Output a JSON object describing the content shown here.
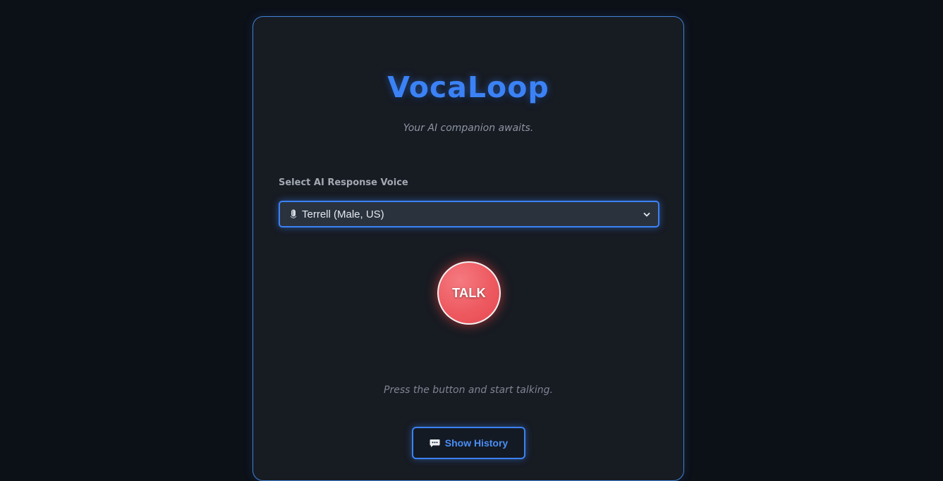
{
  "app": {
    "title": "VocaLoop",
    "subtitle": "Your AI companion awaits."
  },
  "voice": {
    "label": "Select AI Response Voice",
    "selected": "Terrell (Male, US)",
    "icon": "microphone-icon"
  },
  "talk_button": {
    "label": "TALK"
  },
  "status": {
    "text": "Press the button and start talking."
  },
  "history_button": {
    "label": "Show History",
    "icon": "chat-bubble-icon"
  },
  "colors": {
    "accent": "#3b82f6",
    "talk": "#ef5c63",
    "background": "#0c1017",
    "card": "#171b22"
  }
}
